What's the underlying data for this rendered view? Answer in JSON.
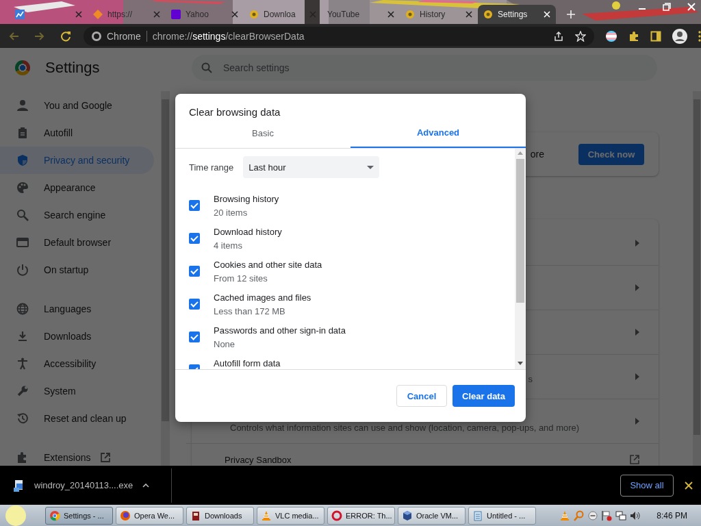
{
  "browser": {
    "tabs": [
      {
        "kind": "chart",
        "selected": false
      },
      {
        "kind": "diamond",
        "title": "https://",
        "selected": false
      },
      {
        "kind": "square",
        "title": "Yahoo",
        "selected": false
      },
      {
        "kind": "gear",
        "title": "Downloa",
        "selected": false
      },
      {
        "title": "YouTube",
        "selected": false
      },
      {
        "kind": "gear",
        "title": "History",
        "selected": false
      },
      {
        "kind": "gear",
        "title": "Settings",
        "selected": true
      }
    ],
    "nav": [
      {
        "kind": "back",
        "disabled": true
      },
      {
        "kind": "forward",
        "disabled": true
      },
      {
        "kind": "reload",
        "disabled": false
      }
    ],
    "omnibox": {
      "site": "Chrome",
      "scheme": "chrome://",
      "host": "settings",
      "path": "/clearBrowserData"
    }
  },
  "settings": {
    "title": "Settings",
    "search": {
      "placeholder": "Search settings"
    },
    "sidebar": [
      [
        {
          "kind": "person",
          "label": "You and Google",
          "selected": false
        },
        {
          "kind": "clipboard",
          "label": "Autofill",
          "selected": false
        },
        {
          "kind": "shield",
          "label": "Privacy and security",
          "selected": true
        },
        {
          "kind": "palette",
          "label": "Appearance",
          "selected": false
        },
        {
          "kind": "search",
          "label": "Search engine",
          "selected": false
        },
        {
          "kind": "browser",
          "label": "Default browser",
          "selected": false
        },
        {
          "kind": "power",
          "label": "On startup",
          "selected": false
        }
      ],
      [
        {
          "kind": "globe",
          "label": "Languages",
          "selected": false
        },
        {
          "kind": "download",
          "label": "Downloads",
          "selected": false
        },
        {
          "kind": "accessibility",
          "label": "Accessibility",
          "selected": false
        },
        {
          "kind": "wrench",
          "label": "System",
          "selected": false
        },
        {
          "kind": "history",
          "label": "Reset and clean up",
          "selected": false
        }
      ],
      [
        {
          "kind": "puzzle",
          "label": "Extensions",
          "selected": false,
          "external": true
        }
      ]
    ],
    "safety_card": {
      "text_fragment": "ore",
      "button": "Check now"
    },
    "privacy_rows": [
      {
        "kind": "chevron"
      },
      {
        "kind": "chevron"
      },
      {
        "kind": "chevron"
      },
      {
        "kind": "chevron",
        "text_fragment": "s"
      },
      {
        "kind": "chevron",
        "description": "Controls what information sites can use and show (location, camera, pop-ups, and more)"
      },
      {
        "kind": "external",
        "title": "Privacy Sandbox"
      }
    ]
  },
  "dialog": {
    "title": "Clear browsing data",
    "tabs": [
      {
        "label": "Basic",
        "selected": false
      },
      {
        "label": "Advanced",
        "selected": true
      }
    ],
    "time_range": {
      "label": "Time range",
      "value": "Last hour"
    },
    "items": [
      {
        "label": "Browsing history",
        "detail": "20 items",
        "checked": true
      },
      {
        "label": "Download history",
        "detail": "4 items",
        "checked": true
      },
      {
        "label": "Cookies and other site data",
        "detail": "From 12 sites",
        "checked": true
      },
      {
        "label": "Cached images and files",
        "detail": "Less than 172 MB",
        "checked": true
      },
      {
        "label": "Passwords and other sign-in data",
        "detail": "None",
        "checked": true
      },
      {
        "label": "Autofill form data",
        "checked": true
      }
    ],
    "buttons": {
      "cancel": "Cancel",
      "confirm": "Clear data"
    }
  },
  "download_shelf": {
    "file": "windroy_20140113....exe",
    "button": "Show all"
  },
  "taskbar": {
    "tasks": [
      {
        "kind": "chrome",
        "label": "Settings - ...",
        "selected": true
      },
      {
        "kind": "firefox",
        "label": "Opera We...",
        "selected": false
      },
      {
        "kind": "box",
        "label": "Downloads",
        "selected": false
      },
      {
        "kind": "cone",
        "label": "VLC media...",
        "selected": false
      },
      {
        "kind": "ring",
        "label": "ERROR: Th...",
        "selected": false
      },
      {
        "kind": "cube",
        "label": "Oracle VM...",
        "selected": false
      },
      {
        "kind": "notepad",
        "label": "Untitled - ...",
        "selected": false
      }
    ],
    "clock": "8:46 PM"
  }
}
